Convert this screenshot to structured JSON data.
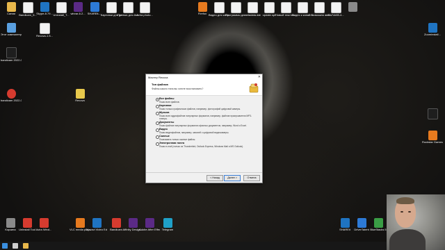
{
  "desktop": {
    "icons_left": [
      {
        "label": "Сании",
        "glyph": "g-folder"
      },
      {
        "label": "Bandicam_5...",
        "glyph": "g-doc"
      },
      {
        "label": "Skype-8.79...",
        "glyph": "g-blue"
      },
      {
        "label": "Uninstall_T...",
        "glyph": "g-doc"
      },
      {
        "label": "winrar-6.2...",
        "glyph": "g-purple"
      },
      {
        "label": "SHAREit-...",
        "glyph": "g-app"
      },
      {
        "label": "Картинки для реклам",
        "glyph": "g-doc"
      },
      {
        "label": "Превью для Avira photo...",
        "glyph": "g-doc"
      },
      {
        "label": "Avira photo...",
        "glyph": "g-doc"
      }
    ],
    "icons_right": [
      {
        "label": "Firefox",
        "glyph": "g-orange"
      },
      {
        "label": "Видео для канала Sah...",
        "glyph": "g-doc"
      },
      {
        "label": "Программы для канала...",
        "glyph": "g-doc"
      },
      {
        "label": "metadata.dat",
        "glyph": "g-doc"
      },
      {
        "label": "update.spf",
        "glyph": "g-doc"
      },
      {
        "label": "Новый текстов...",
        "glyph": "g-doc"
      },
      {
        "label": "Видео к канал на ноуте...",
        "glyph": "g-doc"
      },
      {
        "label": "2 Возможно авторский...",
        "glyph": "g-doc"
      },
      {
        "label": "8fa7cb65-4...",
        "glyph": "g-doc"
      },
      {
        "label": "",
        "glyph": "g-gray"
      }
    ],
    "icons_row2": [
      {
        "label": "Этот компьютер",
        "glyph": "g-pc"
      },
      {
        "label": "Recuva-1.5...",
        "glyph": "g-doc"
      }
    ],
    "icon_bandicam": {
      "label": "bandicam 2022-04-03 ...",
      "glyph": "g-black"
    },
    "icon_bandicam2": {
      "label": "bandicam 2022-04-03 ...",
      "glyph": "g-red"
    },
    "icon_recuva": {
      "label": "Recuva",
      "glyph": "g-yellow"
    },
    "icon_zoom": {
      "label": "ZoominstalI...",
      "glyph": "g-blue"
    },
    "icon_rockstar": {
      "label": "Rockstar Games...",
      "glyph": "g-orange"
    },
    "icons_bottom_left": [
      {
        "label": "Корзина",
        "glyph": "g-gray"
      },
      {
        "label": "Uninstall Tool",
        "glyph": "g-red"
      },
      {
        "label": "Avira Wind...",
        "glyph": "g-red"
      },
      {
        "label": "VLC media player",
        "glyph": "g-orange"
      },
      {
        "label": "Movavi Video Editor Plus",
        "glyph": "g-blue"
      },
      {
        "label": "Bandicam",
        "glyph": "g-red"
      },
      {
        "label": "Affinity Design...",
        "glyph": "g-purple"
      },
      {
        "label": "Adobe After Effects 2022",
        "glyph": "g-purple"
      },
      {
        "label": "Telegram",
        "glyph": "g-cyan"
      }
    ],
    "icons_bottom_right": [
      {
        "label": "SHAREit",
        "glyph": "g-blue"
      },
      {
        "label": "DriverTalent",
        "glyph": "g-app"
      },
      {
        "label": "BlueStacks 5",
        "glyph": "g-green"
      },
      {
        "label": "ZoomIt",
        "glyph": "g-gray"
      },
      {
        "label": "GameDown...",
        "glyph": "g-black"
      }
    ]
  },
  "wizard": {
    "window_title": "Мастер Recuva",
    "close_glyph": "✕",
    "header_title": "Тип файлов",
    "header_subtitle": "Файлы какого типа вы хотите восстановить?",
    "options": [
      {
        "title": "Все файлы",
        "desc": "Показ всех файлов.",
        "selected": true
      },
      {
        "title": "Картинки",
        "desc": "Показ только графических файлов, например, фотографий цифровой камеры.",
        "selected": false
      },
      {
        "title": "Музыка",
        "desc": "Показ всех аудиофайлов популярных форматов, например, файлов проигрывателя MP3-плеера.",
        "selected": false
      },
      {
        "title": "Документы",
        "desc": "Показ файлов популярных форматов офисных документов, например, Word и Excel.",
        "selected": false
      },
      {
        "title": "Видео",
        "desc": "Показ видеофайлов, например, записей с цифровой видеокамеры.",
        "selected": false
      },
      {
        "title": "Сжатые",
        "desc": "Показывать только сжатые файлы.",
        "selected": false
      },
      {
        "title": "Электронная почта",
        "desc": "Показ e-mail (только из Thunderbird, Outlook Express, Windows Mail и MS Outlook).",
        "selected": false
      }
    ],
    "back_label": "< Назад",
    "next_label": "Далее >",
    "cancel_label": "Отмена"
  }
}
